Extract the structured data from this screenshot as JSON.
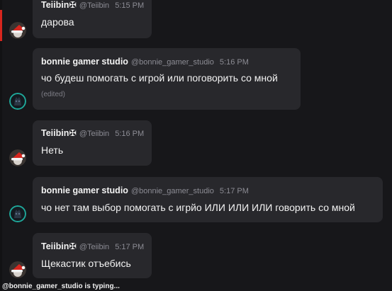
{
  "messages": [
    {
      "author": "Teiibin✠",
      "handle": "@Teiibin",
      "time": "5:15 PM",
      "text": "дарова",
      "avatar": "santa-hat-avatar-icon"
    },
    {
      "author": "bonnie gamer studio",
      "handle": "@bonnie_gamer_studio",
      "time": "5:16 PM",
      "text": "чо будеш помогать с игрой или поговорить со мной",
      "edited": "(edited)",
      "avatar": "dark-creature-avatar-icon"
    },
    {
      "author": "Teiibin✠",
      "handle": "@Teiibin",
      "time": "5:16 PM",
      "text": "Неть",
      "avatar": "santa-hat-avatar-icon"
    },
    {
      "author": "bonnie gamer studio",
      "handle": "@bonnie_gamer_studio",
      "time": "5:17 PM",
      "text": "чо нет там выбор помогать с игрйо ИЛИ ИЛИ ИЛИ говорить со мной",
      "avatar": "dark-creature-avatar-icon"
    },
    {
      "author": "Teiibin✠",
      "handle": "@Teiibin",
      "time": "5:17 PM",
      "text": "Щекастик отъебись",
      "avatar": "santa-hat-avatar-icon"
    }
  ],
  "typing_indicator": "@bonnie_gamer_studio is typing...",
  "colors": {
    "background": "#17171a",
    "bubble": "#28282c",
    "text": "#f2f2f2",
    "muted": "#8c8c94",
    "accent_ring": "#1fa89a",
    "hat_red": "#d7261e"
  }
}
